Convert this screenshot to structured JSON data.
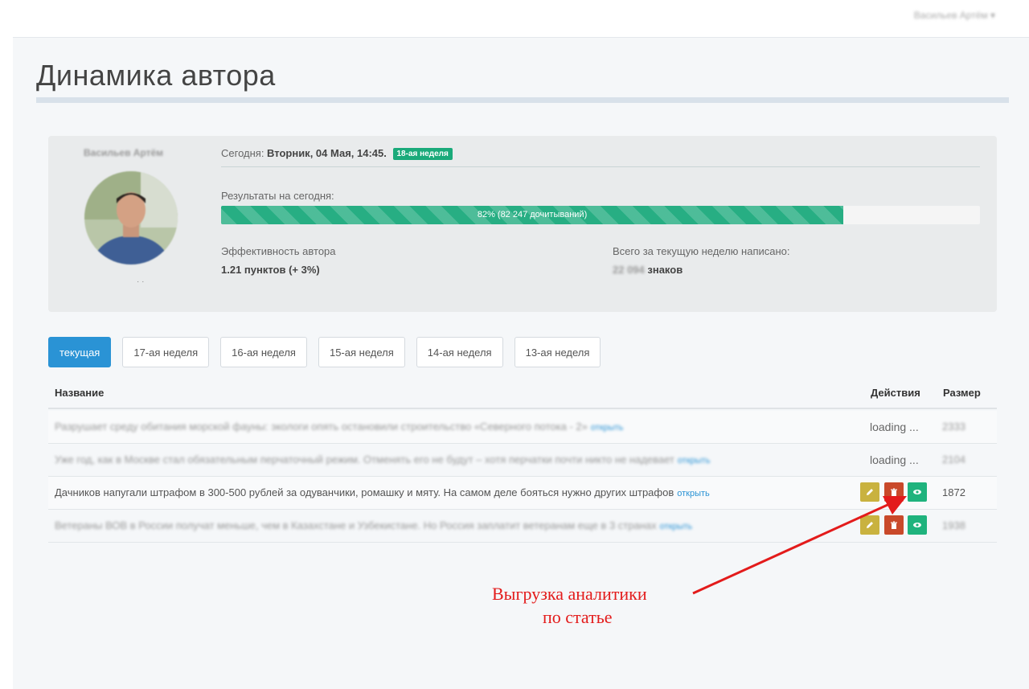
{
  "header": {
    "user_menu": "Васильев Артём ▾"
  },
  "page": {
    "title": "Динамика автора"
  },
  "author": {
    "name": "Васильев Артём",
    "avatar_note": "· ·",
    "today_prefix": "Сегодня: ",
    "today_date": "Вторник, 04 Мая, 14:45.",
    "week_badge": "18-ая неделя",
    "results_label": "Результаты на сегодня:",
    "progress_text": "82% (82 247 дочитываний)",
    "progress_percent": 82,
    "efficiency_label": "Эффективность автора",
    "efficiency_value": "1.21 пунктов (+ 3%)",
    "week_written_label": "Всего за текущую неделю написано:",
    "week_written_number": "22 094",
    "week_written_unit": " знаков"
  },
  "tabs": [
    {
      "label": "текущая",
      "active": true
    },
    {
      "label": "17-ая неделя",
      "active": false
    },
    {
      "label": "16-ая неделя",
      "active": false
    },
    {
      "label": "15-ая неделя",
      "active": false
    },
    {
      "label": "14-ая неделя",
      "active": false
    },
    {
      "label": "13-ая неделя",
      "active": false
    }
  ],
  "table": {
    "headers": {
      "name": "Название",
      "actions": "Действия",
      "size": "Размер"
    },
    "open_link": "открыть",
    "rows": [
      {
        "title": "Разрушает среду обитания морской фауны: экологи опять остановили строительство «Северного потока - 2»",
        "status": "loading ...",
        "size": "2333"
      },
      {
        "title": "Уже год, как в Москве стал обязательным перчаточный режим. Отменять его не будут – хотя перчатки почти никто не надевает",
        "status": "loading ...",
        "size": "2104"
      },
      {
        "title": "Дачников напугали штрафом в 300-500 рублей за одуванчики, ромашку и мяту. На самом деле бояться нужно других штрафов",
        "status": "",
        "size": "1872"
      },
      {
        "title": "Ветераны ВОВ в России получат меньше, чем в Казахстане и Узбекистане. Но Россия заплатит ветеранам еще в 3 странах",
        "status": "",
        "size": "1938"
      }
    ]
  },
  "annotation": {
    "line1": "Выгрузка аналитики",
    "line2": "по статье",
    "color": "#e31b1b"
  },
  "colors": {
    "accent": "#2a93d5",
    "progress": "#27ae83",
    "edit": "#c9b23f",
    "delete": "#c9492a",
    "view": "#1fb37d"
  }
}
